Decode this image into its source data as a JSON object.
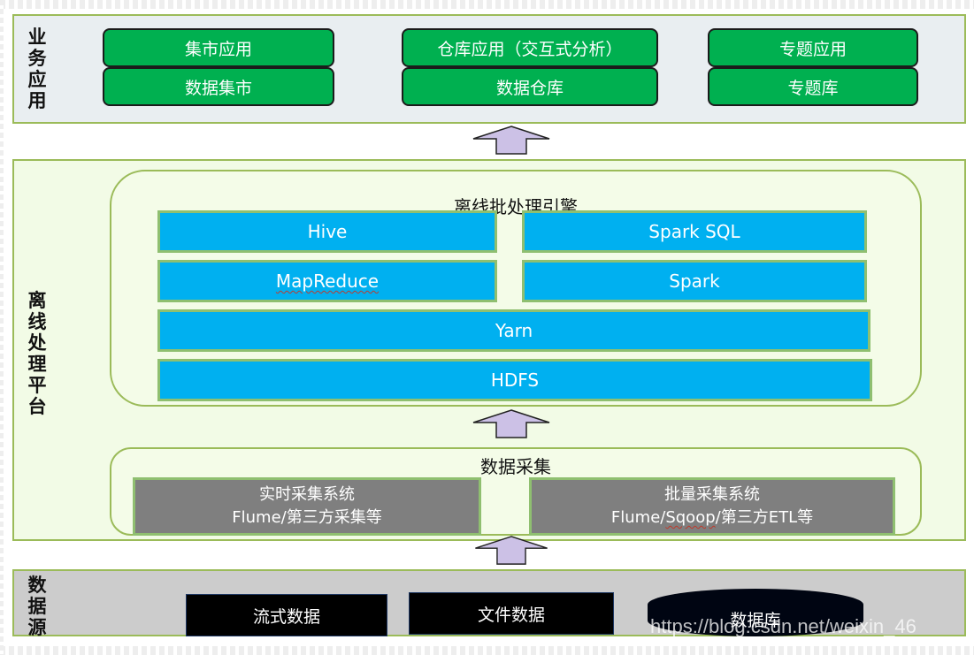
{
  "layers": {
    "business": {
      "label": "业\n务\n应\n用",
      "boxes": [
        {
          "top": "集市应用",
          "bottom": "数据集市"
        },
        {
          "top": "仓库应用（交互式分析）",
          "bottom": "数据仓库"
        },
        {
          "top": "专题应用",
          "bottom": "专题库"
        }
      ]
    },
    "offline": {
      "label": "离\n线\n处\n理\n平\n台",
      "engine": {
        "title": "离线批处理引擎",
        "hive": "Hive",
        "spark_sql": "Spark SQL",
        "mapreduce": "MapReduce",
        "spark": "Spark",
        "yarn": "Yarn",
        "hdfs": "HDFS"
      },
      "collection": {
        "title": "数据采集",
        "realtime": {
          "line1": "实时采集系统",
          "line2": "Flume/第三方采集等"
        },
        "batch": {
          "line1": "批量采集系统",
          "line2_prefix": "Flume/",
          "line2_sqoop": "Sqoop",
          "line2_suffix": "/第三方ETL等"
        }
      }
    },
    "source": {
      "label": "数\n据\n源",
      "items": [
        "流式数据",
        "文件数据",
        "数据库"
      ]
    }
  },
  "arrows": [
    "up-arrow",
    "up-arrow",
    "up-arrow"
  ],
  "colors": {
    "green": "#00b050",
    "blue": "#00b0f0",
    "gray": "#7f7f7f",
    "border_green": "#9bbb59",
    "arrow_fill": "#ccc1e6"
  },
  "watermark": "https://blog.csdn.net/weixin_46"
}
